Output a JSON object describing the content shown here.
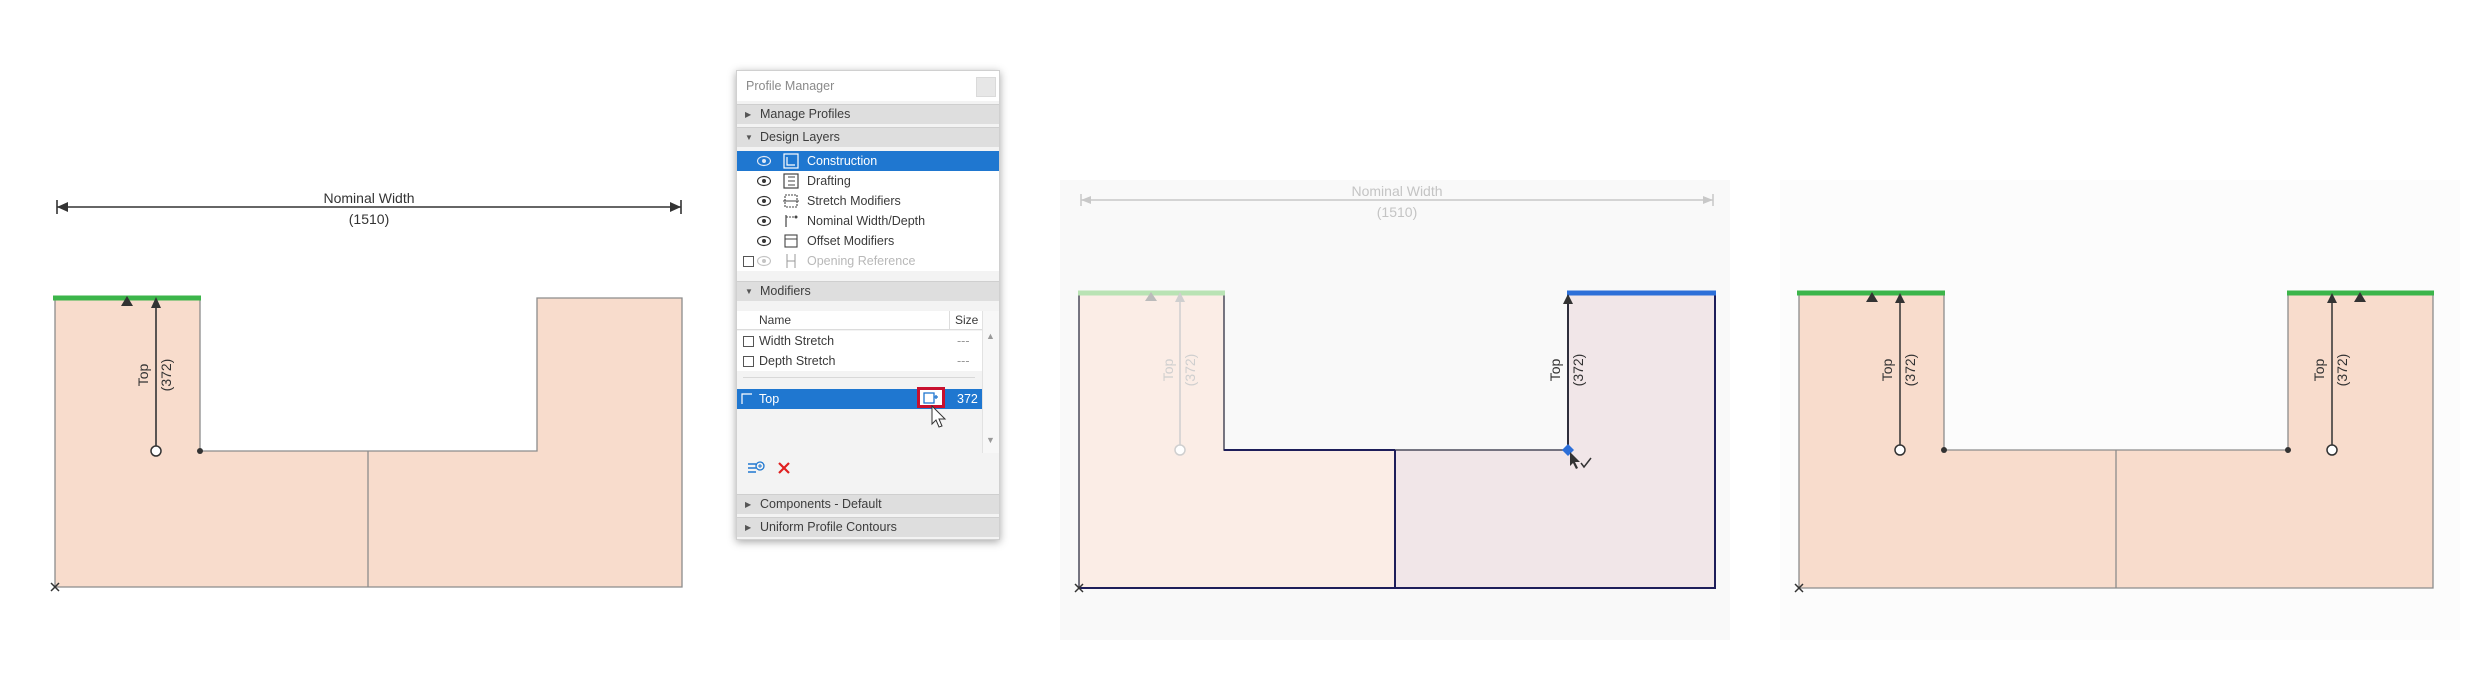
{
  "profile_manager": {
    "title": "Profile Manager",
    "sections": {
      "manage_profiles": "Manage Profiles",
      "design_layers": "Design Layers",
      "modifiers": "Modifiers",
      "components": "Components - Default",
      "uniform_contours": "Uniform Profile Contours"
    },
    "layers": [
      {
        "label": "Construction",
        "icon": "construction-layer-icon",
        "visible": true,
        "selected": true
      },
      {
        "label": "Drafting",
        "icon": "drafting-layer-icon",
        "visible": true,
        "selected": false
      },
      {
        "label": "Stretch Modifiers",
        "icon": "stretch-modifiers-icon",
        "visible": true,
        "selected": false
      },
      {
        "label": "Nominal Width/Depth",
        "icon": "nominal-width-depth-icon",
        "visible": true,
        "selected": false
      },
      {
        "label": "Offset Modifiers",
        "icon": "offset-modifiers-icon",
        "visible": true,
        "selected": false
      },
      {
        "label": "Opening Reference",
        "icon": "opening-reference-icon",
        "visible": false,
        "selected": false
      }
    ],
    "modifier_columns": {
      "name": "Name",
      "size": "Size"
    },
    "modifiers": [
      {
        "name": "Width Stretch",
        "size": "---"
      },
      {
        "name": "Depth Stretch",
        "size": "---"
      },
      {
        "name": "Top",
        "size": "372",
        "selected": true
      }
    ],
    "accent_color": "#1f77d0",
    "highlight_color": "#c8102e"
  },
  "drawings": {
    "nominal_width_label": "Nominal Width",
    "nominal_width_value": "(1510)",
    "offset_label": "Top",
    "offset_value": "(372)"
  }
}
